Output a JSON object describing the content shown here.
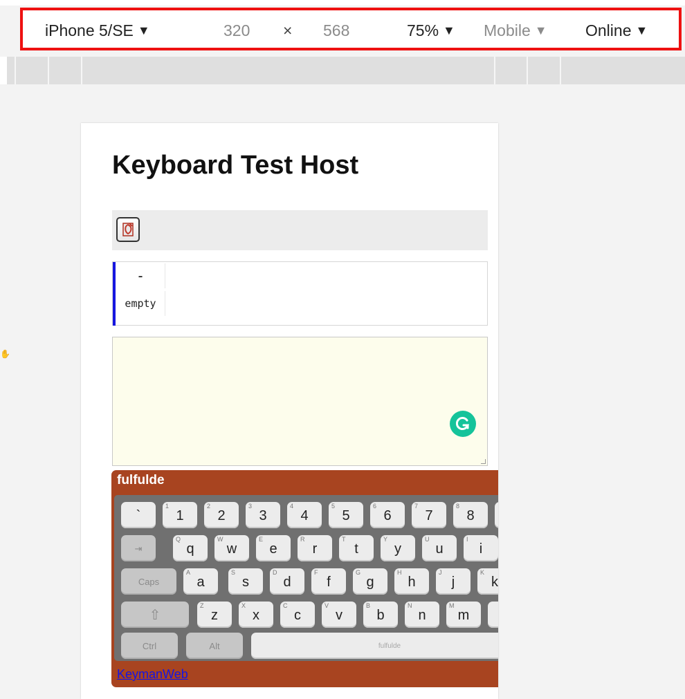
{
  "devtools": {
    "device": "iPhone 5/SE",
    "width": "320",
    "times": "×",
    "height": "568",
    "zoom": "75%",
    "throttle_mode": "Mobile",
    "network": "Online",
    "caret": "▼"
  },
  "page": {
    "title": "Keyboard Test Host",
    "kmw_button_icon": "keyman-icon",
    "context": {
      "cell_top": "-",
      "cell_bottom": "empty"
    },
    "textarea": {
      "value": "",
      "grammarly_icon": "grammarly-icon"
    }
  },
  "keyboard": {
    "name": "fulfulde",
    "rows": [
      [
        {
          "cap": "`",
          "sub": ""
        },
        {
          "cap": "1",
          "sub": "1"
        },
        {
          "cap": "2",
          "sub": "2"
        },
        {
          "cap": "3",
          "sub": "3"
        },
        {
          "cap": "4",
          "sub": "4"
        },
        {
          "cap": "5",
          "sub": "5"
        },
        {
          "cap": "6",
          "sub": "6"
        },
        {
          "cap": "7",
          "sub": "7"
        },
        {
          "cap": "8",
          "sub": "8"
        }
      ],
      [
        {
          "cap": "q",
          "sub": "Q"
        },
        {
          "cap": "w",
          "sub": "W"
        },
        {
          "cap": "e",
          "sub": "E"
        },
        {
          "cap": "r",
          "sub": "R"
        },
        {
          "cap": "t",
          "sub": "T"
        },
        {
          "cap": "y",
          "sub": "Y"
        },
        {
          "cap": "u",
          "sub": "U"
        },
        {
          "cap": "i",
          "sub": "I"
        }
      ],
      [
        {
          "cap": "a",
          "sub": "A"
        },
        {
          "cap": "s",
          "sub": "S"
        },
        {
          "cap": "d",
          "sub": "D"
        },
        {
          "cap": "f",
          "sub": "F"
        },
        {
          "cap": "g",
          "sub": "G"
        },
        {
          "cap": "h",
          "sub": "H"
        },
        {
          "cap": "j",
          "sub": "J"
        },
        {
          "cap": "k",
          "sub": "K"
        }
      ],
      [
        {
          "cap": "z",
          "sub": "Z"
        },
        {
          "cap": "x",
          "sub": "X"
        },
        {
          "cap": "c",
          "sub": "C"
        },
        {
          "cap": "v",
          "sub": "V"
        },
        {
          "cap": "b",
          "sub": "B"
        },
        {
          "cap": "n",
          "sub": "N"
        },
        {
          "cap": "m",
          "sub": "M"
        }
      ]
    ],
    "special": {
      "tab": "⇥",
      "caps": "Caps",
      "shift": "⇧",
      "ctrl": "Ctrl",
      "alt": "Alt",
      "space": "fulfulde"
    },
    "link": "KeymanWeb",
    "colors": {
      "frame": "#a84420",
      "body": "#707070"
    }
  }
}
